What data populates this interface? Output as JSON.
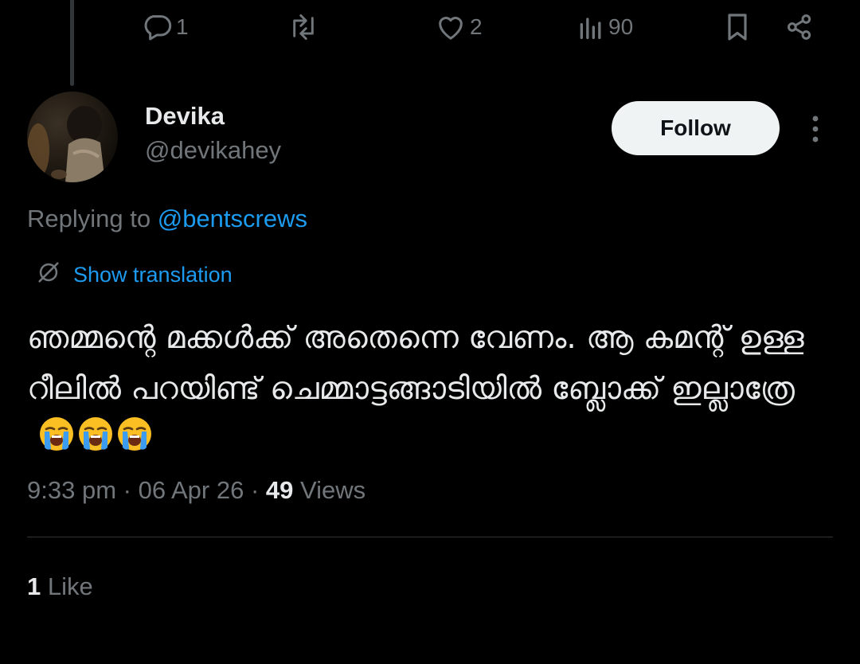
{
  "previous_tweet_actions": {
    "reply_count": "1",
    "retweet_count": "",
    "like_count": "2",
    "view_count": "90"
  },
  "tweet": {
    "author": {
      "display_name": "Devika",
      "handle": "@devikahey"
    },
    "follow_label": "Follow",
    "replying_prefix": "Replying to",
    "replying_to": "@bentscrews",
    "translate_label": "Show translation",
    "text": "ഞമ്മന്റെ മക്കൾക്ക് അതെന്നെ വേണം. ആ കമന്റ് ഉള്ള റീലിൽ പറയിണ്ട് ചെമ്മാട്ടങ്ങാടിയിൽ ബ്ലോക്ക് ഇല്ലാത്രേ",
    "emojis": [
      "loudly-crying-face",
      "loudly-crying-face",
      "loudly-crying-face"
    ],
    "time": "9:33 pm",
    "separator": "·",
    "date": "06 Apr 26",
    "views_count": "49",
    "views_label": "Views",
    "likes_count": "1",
    "likes_label": "Like"
  },
  "icons": {
    "reply": "reply-icon",
    "retweet": "retweet-icon",
    "like": "heart-icon",
    "views": "views-icon",
    "bookmark": "bookmark-icon",
    "share": "share-icon",
    "more": "more-vertical-icon",
    "translate": "globe-slash-icon"
  },
  "colors": {
    "background": "#000000",
    "text_primary": "#e7e9ea",
    "text_secondary": "#71767b",
    "link": "#1d9bf0",
    "follow_bg": "#eff3f4",
    "divider": "#2f3336"
  }
}
